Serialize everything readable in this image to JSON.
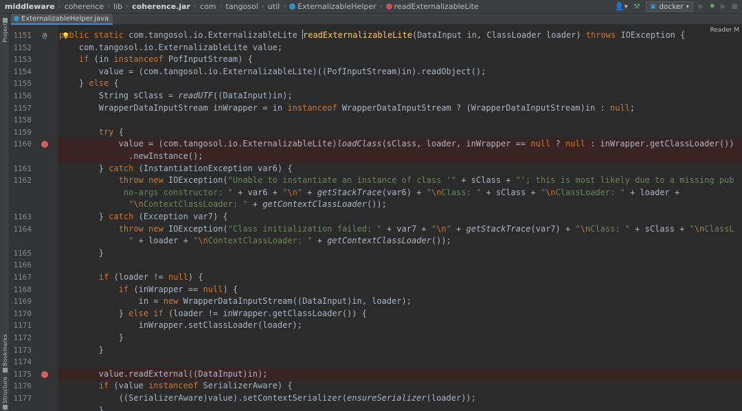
{
  "breadcrumbs": [
    "middleware",
    "coherence",
    "lib",
    "coherence.jar",
    "com",
    "tangosol",
    "util",
    "ExternalizableHelper",
    "readExternalizableLite"
  ],
  "run_config": "docker",
  "tab": {
    "label": "ExternalizableHelper.java"
  },
  "tool_windows": {
    "project": "Project",
    "bookmarks": "Bookmarks",
    "structure": "Structure"
  },
  "reader_mode": "Reader M",
  "colors": {
    "keyword": "#cc7832",
    "string": "#6a8759",
    "method": "#ffc66d",
    "breakpoint": "#db5c5c",
    "background": "#2b2b2b"
  },
  "lines": [
    {
      "num": "1151",
      "marker": "override",
      "tokens": [
        {
          "t": "public static ",
          "c": "kw"
        },
        {
          "t": "com.tangosol.io.ExternalizableLite "
        },
        {
          "t": "",
          "c": "caret"
        },
        {
          "t": "readExternalizableLite",
          "c": "mcall"
        },
        {
          "t": "(DataInput in, ClassLoader loader) "
        },
        {
          "t": "throws ",
          "c": "kw"
        },
        {
          "t": "IOException {"
        }
      ]
    },
    {
      "num": "1152",
      "tokens": [
        {
          "t": "    com.tangosol.io.ExternalizableLite value;"
        }
      ]
    },
    {
      "num": "1153",
      "tokens": [
        {
          "t": "    "
        },
        {
          "t": "if ",
          "c": "kw"
        },
        {
          "t": "(in "
        },
        {
          "t": "instanceof ",
          "c": "kw"
        },
        {
          "t": "PofInputStream) {"
        }
      ]
    },
    {
      "num": "1154",
      "tokens": [
        {
          "t": "        value = (com.tangosol.io.ExternalizableLite)((PofInputStream)in).readObject();"
        }
      ]
    },
    {
      "num": "1155",
      "tokens": [
        {
          "t": "    } "
        },
        {
          "t": "else ",
          "c": "kw"
        },
        {
          "t": "{"
        }
      ]
    },
    {
      "num": "1156",
      "tokens": [
        {
          "t": "        String sClass = "
        },
        {
          "t": "readUTF",
          "c": "it"
        },
        {
          "t": "((DataInput)in);"
        }
      ]
    },
    {
      "num": "1157",
      "tokens": [
        {
          "t": "        WrapperDataInputStream inWrapper = in "
        },
        {
          "t": "instanceof ",
          "c": "kw"
        },
        {
          "t": "WrapperDataInputStream ? (WrapperDataInputStream)in : "
        },
        {
          "t": "null",
          "c": "kw"
        },
        {
          "t": ";"
        }
      ]
    },
    {
      "num": "1158",
      "tokens": []
    },
    {
      "num": "1159",
      "tokens": [
        {
          "t": "        "
        },
        {
          "t": "try ",
          "c": "kw"
        },
        {
          "t": "{"
        }
      ]
    },
    {
      "num": "1160",
      "breakpoint": true,
      "tokens": [
        {
          "t": "            value = (com.tangosol.io.ExternalizableLite)"
        },
        {
          "t": "loadClass",
          "c": "it"
        },
        {
          "t": "(sClass, loader, inWrapper == "
        },
        {
          "t": "null ",
          "c": "kw"
        },
        {
          "t": "? "
        },
        {
          "t": "null ",
          "c": "kw"
        },
        {
          "t": ": inWrapper.getClassLoader())"
        }
      ]
    },
    {
      "num": "",
      "breakpoint": true,
      "tokens": [
        {
          "t": "              .newInstance();"
        }
      ]
    },
    {
      "num": "1161",
      "tokens": [
        {
          "t": "        } "
        },
        {
          "t": "catch ",
          "c": "kw"
        },
        {
          "t": "(InstantiationException var6) {"
        }
      ]
    },
    {
      "num": "1162",
      "tokens": [
        {
          "t": "            "
        },
        {
          "t": "throw new ",
          "c": "kw"
        },
        {
          "t": "IOException("
        },
        {
          "t": "\"Unable to instantiate an instance of class '\"",
          "c": "str"
        },
        {
          "t": " + sClass + "
        },
        {
          "t": "\"'; this is most likely due to a missing pub",
          "c": "str"
        }
      ]
    },
    {
      "num": "",
      "tokens": [
        {
          "t": "             "
        },
        {
          "t": "no-args constructor: \"",
          "c": "str"
        },
        {
          "t": " + var6 + "
        },
        {
          "t": "\"",
          "c": "str"
        },
        {
          "t": "\\n",
          "c": "esc"
        },
        {
          "t": "\"",
          "c": "str"
        },
        {
          "t": " + "
        },
        {
          "t": "getStackTrace",
          "c": "it"
        },
        {
          "t": "(var6) + "
        },
        {
          "t": "\"",
          "c": "str"
        },
        {
          "t": "\\n",
          "c": "esc"
        },
        {
          "t": "Class: \"",
          "c": "str"
        },
        {
          "t": " + sClass + "
        },
        {
          "t": "\"",
          "c": "str"
        },
        {
          "t": "\\n",
          "c": "esc"
        },
        {
          "t": "ClassLoader: \"",
          "c": "str"
        },
        {
          "t": " + loader +"
        }
      ]
    },
    {
      "num": "",
      "tokens": [
        {
          "t": "              "
        },
        {
          "t": "\"",
          "c": "str"
        },
        {
          "t": "\\n",
          "c": "esc"
        },
        {
          "t": "ContextClassLoader: \"",
          "c": "str"
        },
        {
          "t": " + "
        },
        {
          "t": "getContextClassLoader",
          "c": "it"
        },
        {
          "t": "());"
        }
      ]
    },
    {
      "num": "1163",
      "tokens": [
        {
          "t": "        } "
        },
        {
          "t": "catch ",
          "c": "kw"
        },
        {
          "t": "(Exception var7) {"
        }
      ]
    },
    {
      "num": "1164",
      "tokens": [
        {
          "t": "            "
        },
        {
          "t": "throw new ",
          "c": "kw"
        },
        {
          "t": "IOException("
        },
        {
          "t": "\"Class initialization failed: \"",
          "c": "str"
        },
        {
          "t": " + var7 + "
        },
        {
          "t": "\"",
          "c": "str"
        },
        {
          "t": "\\n",
          "c": "esc"
        },
        {
          "t": "\"",
          "c": "str"
        },
        {
          "t": " + "
        },
        {
          "t": "getStackTrace",
          "c": "it"
        },
        {
          "t": "(var7) + "
        },
        {
          "t": "\"",
          "c": "str"
        },
        {
          "t": "\\n",
          "c": "esc"
        },
        {
          "t": "Class: \"",
          "c": "str"
        },
        {
          "t": " + sClass + "
        },
        {
          "t": "\"",
          "c": "str"
        },
        {
          "t": "\\n",
          "c": "esc"
        },
        {
          "t": "ClassL",
          "c": "str"
        }
      ]
    },
    {
      "num": "",
      "tokens": [
        {
          "t": "              "
        },
        {
          "t": "\"",
          "c": "str"
        },
        {
          "t": " + loader + "
        },
        {
          "t": "\"",
          "c": "str"
        },
        {
          "t": "\\n",
          "c": "esc"
        },
        {
          "t": "ContextClassLoader: \"",
          "c": "str"
        },
        {
          "t": " + "
        },
        {
          "t": "getContextClassLoader",
          "c": "it"
        },
        {
          "t": "());"
        }
      ]
    },
    {
      "num": "1165",
      "tokens": [
        {
          "t": "        }"
        }
      ]
    },
    {
      "num": "1166",
      "tokens": []
    },
    {
      "num": "1167",
      "tokens": [
        {
          "t": "        "
        },
        {
          "t": "if ",
          "c": "kw"
        },
        {
          "t": "(loader != "
        },
        {
          "t": "null",
          "c": "kw"
        },
        {
          "t": ") {"
        }
      ]
    },
    {
      "num": "1168",
      "tokens": [
        {
          "t": "            "
        },
        {
          "t": "if ",
          "c": "kw"
        },
        {
          "t": "(inWrapper == "
        },
        {
          "t": "null",
          "c": "kw"
        },
        {
          "t": ") {"
        }
      ]
    },
    {
      "num": "1169",
      "tokens": [
        {
          "t": "                in = "
        },
        {
          "t": "new ",
          "c": "kw"
        },
        {
          "t": "WrapperDataInputStream((DataInput)in, loader);"
        }
      ]
    },
    {
      "num": "1170",
      "tokens": [
        {
          "t": "            } "
        },
        {
          "t": "else if ",
          "c": "kw"
        },
        {
          "t": "(loader != inWrapper.getClassLoader()) {"
        }
      ]
    },
    {
      "num": "1171",
      "tokens": [
        {
          "t": "                inWrapper.setClassLoader(loader);"
        }
      ]
    },
    {
      "num": "1172",
      "tokens": [
        {
          "t": "            }"
        }
      ]
    },
    {
      "num": "1173",
      "tokens": [
        {
          "t": "        }"
        }
      ]
    },
    {
      "num": "1174",
      "tokens": []
    },
    {
      "num": "1175",
      "breakpoint": true,
      "tokens": [
        {
          "t": "        value.readExternal((DataInput)in);"
        }
      ]
    },
    {
      "num": "1176",
      "tokens": [
        {
          "t": "        "
        },
        {
          "t": "if ",
          "c": "kw"
        },
        {
          "t": "(value "
        },
        {
          "t": "instanceof ",
          "c": "kw"
        },
        {
          "t": "SerializerAware) {"
        }
      ]
    },
    {
      "num": "1177",
      "tokens": [
        {
          "t": "            ((SerializerAware)value).setContextSerializer("
        },
        {
          "t": "ensureSerializer",
          "c": "it"
        },
        {
          "t": "(loader));"
        }
      ]
    },
    {
      "num": "",
      "tokens": [
        {
          "t": "        }"
        }
      ]
    }
  ]
}
